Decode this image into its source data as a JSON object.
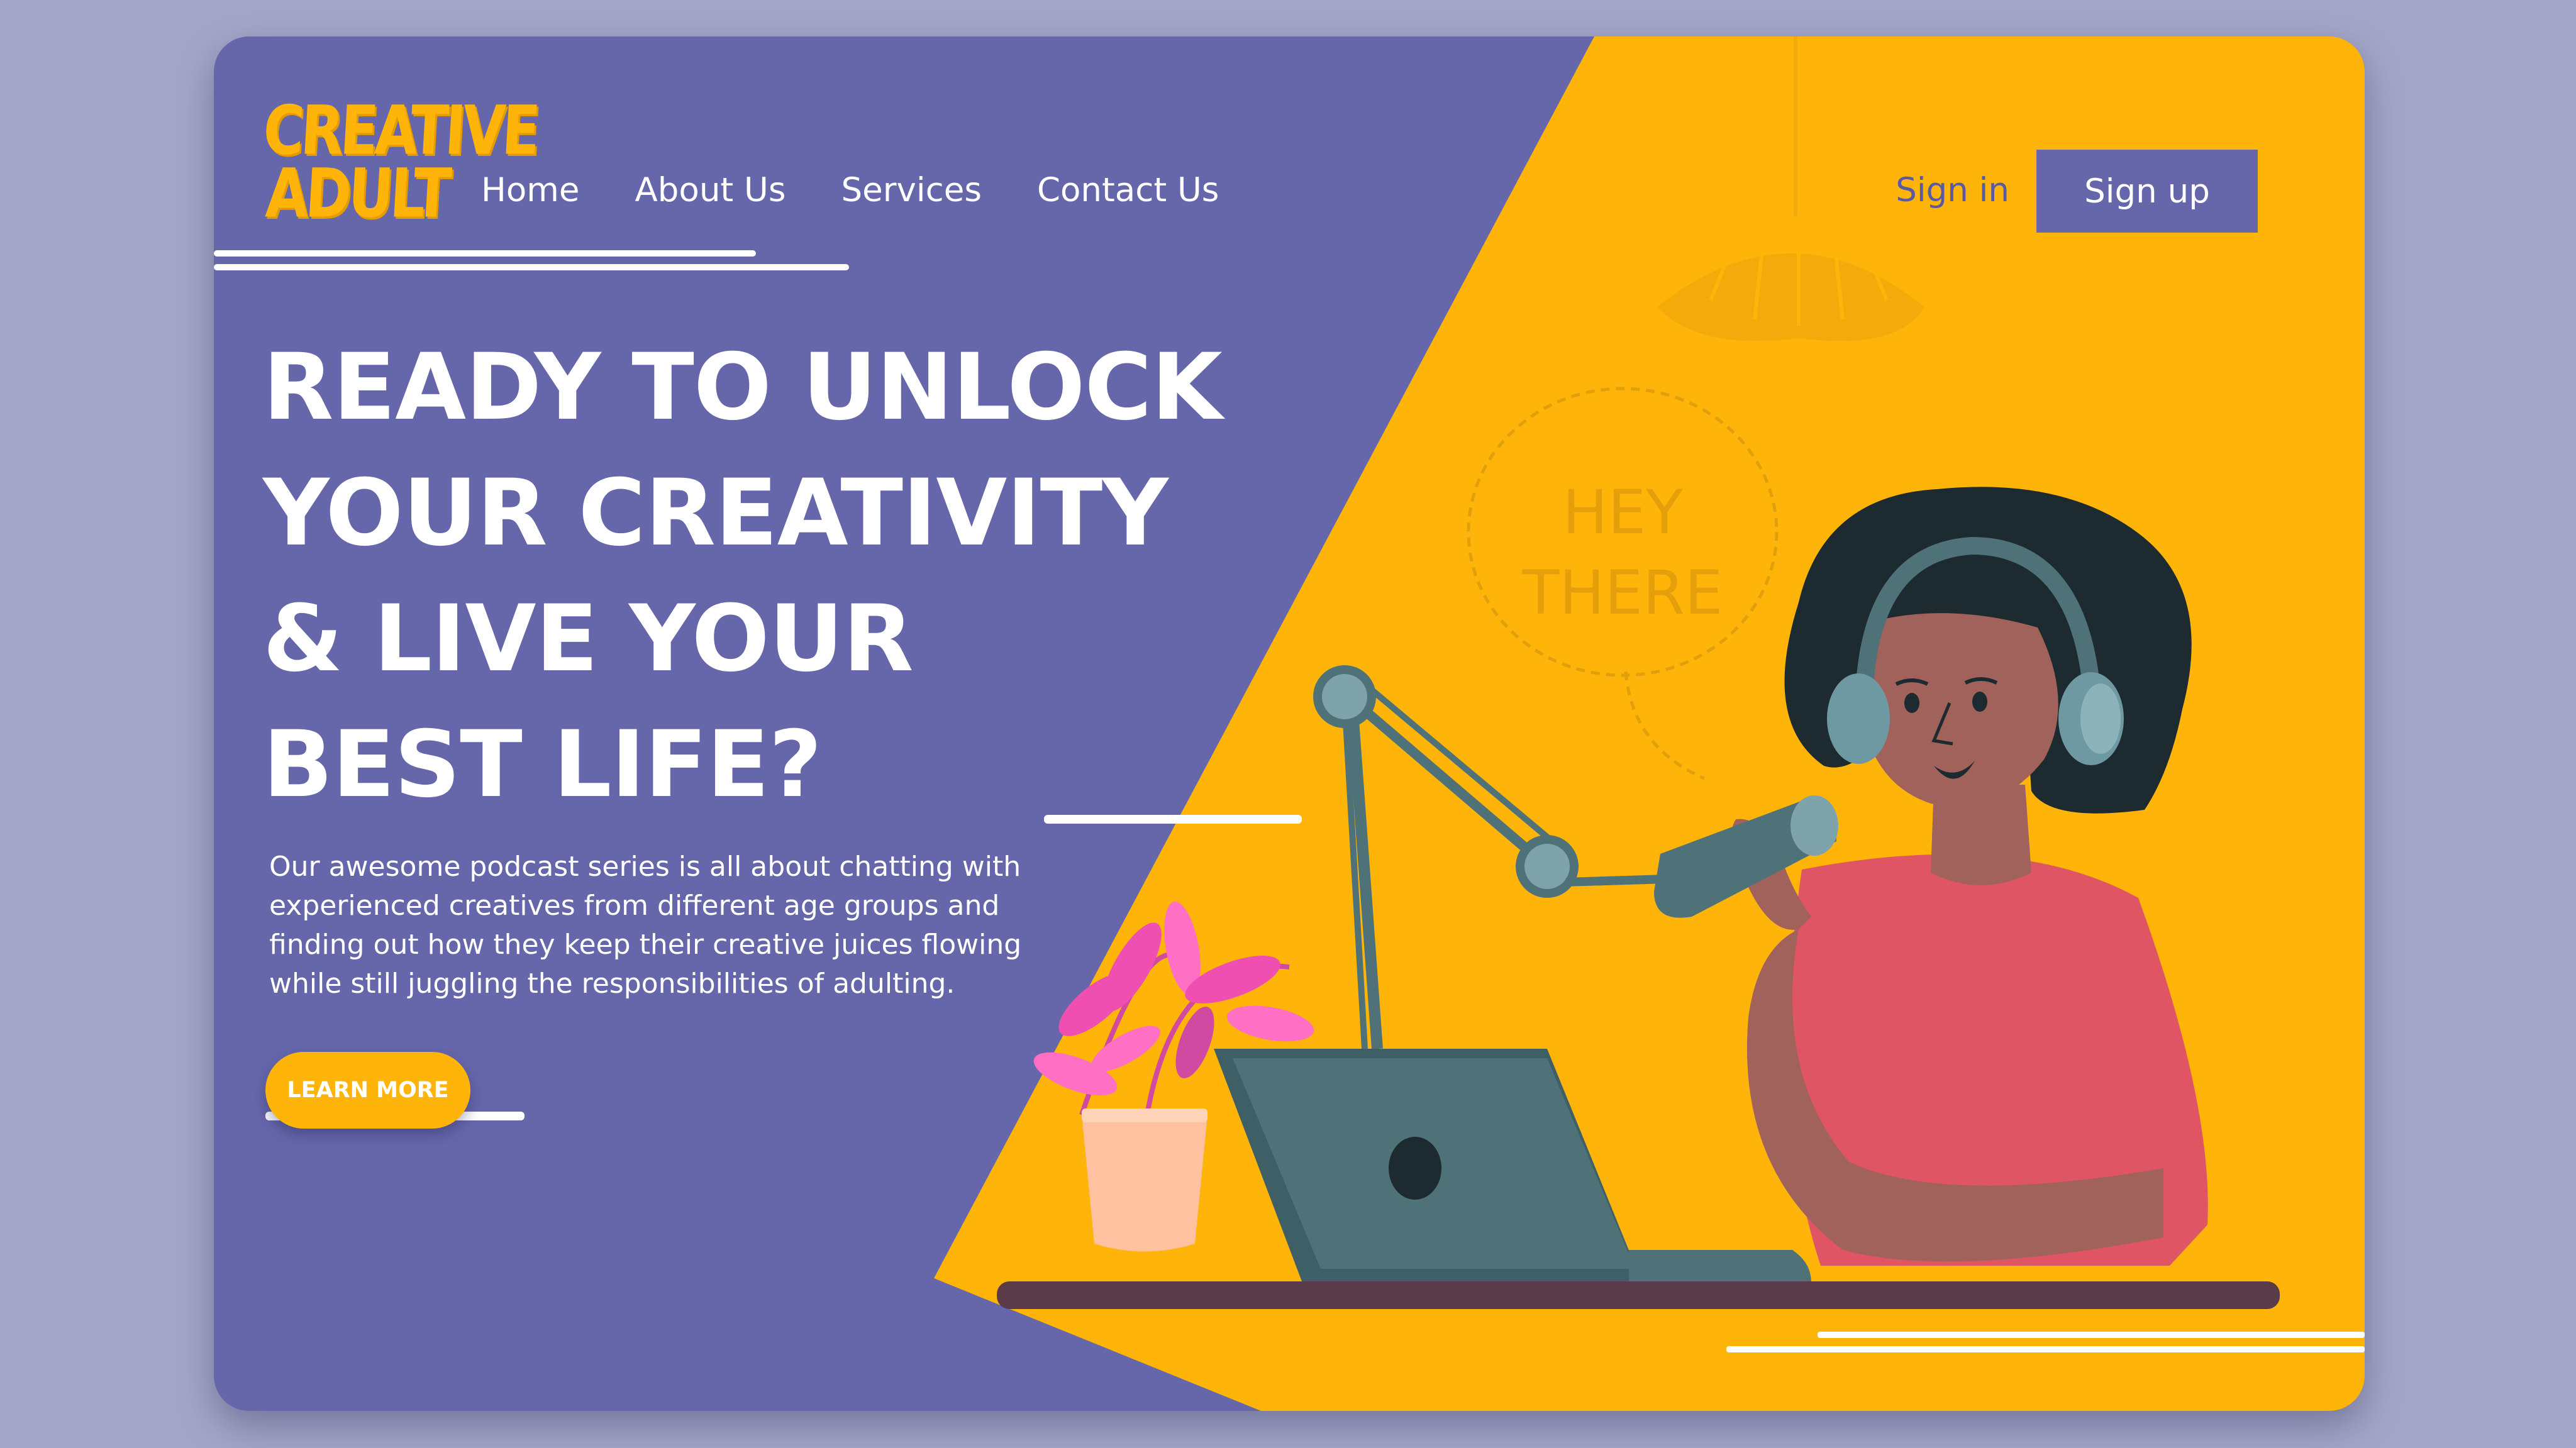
{
  "brand": {
    "logo_line1": "CREATIVE",
    "logo_line2": "ADULT"
  },
  "nav": {
    "items": [
      {
        "label": "Home"
      },
      {
        "label": "About Us"
      },
      {
        "label": "Services"
      },
      {
        "label": "Contact Us"
      }
    ]
  },
  "auth": {
    "signin_label": "Sign in",
    "signup_label": "Sign up"
  },
  "hero": {
    "headline_lines": [
      "READY TO UNLOCK",
      "YOUR CREATIVITY",
      "& LIVE YOUR",
      "BEST LIFE?"
    ],
    "body_lines": [
      "Our awesome podcast series is all about chatting with",
      "experienced creatives from different age groups and",
      "finding out how they keep their creative juices flowing",
      "while still juggling the responsibilities of adulting."
    ],
    "cta_label": "LEARN MORE"
  },
  "illustration": {
    "speech_bubble_line1": "HEY",
    "speech_bubble_line2": "THERE"
  },
  "colors": {
    "page_background": "#a4a6c9",
    "purple": "#6667aa",
    "yellow": "#ffb40a",
    "white": "#ffffff",
    "shirt_coral": "#e05563",
    "skin": "#a0625a",
    "hair": "#1d2a30",
    "device_slate": "#4f7279"
  }
}
